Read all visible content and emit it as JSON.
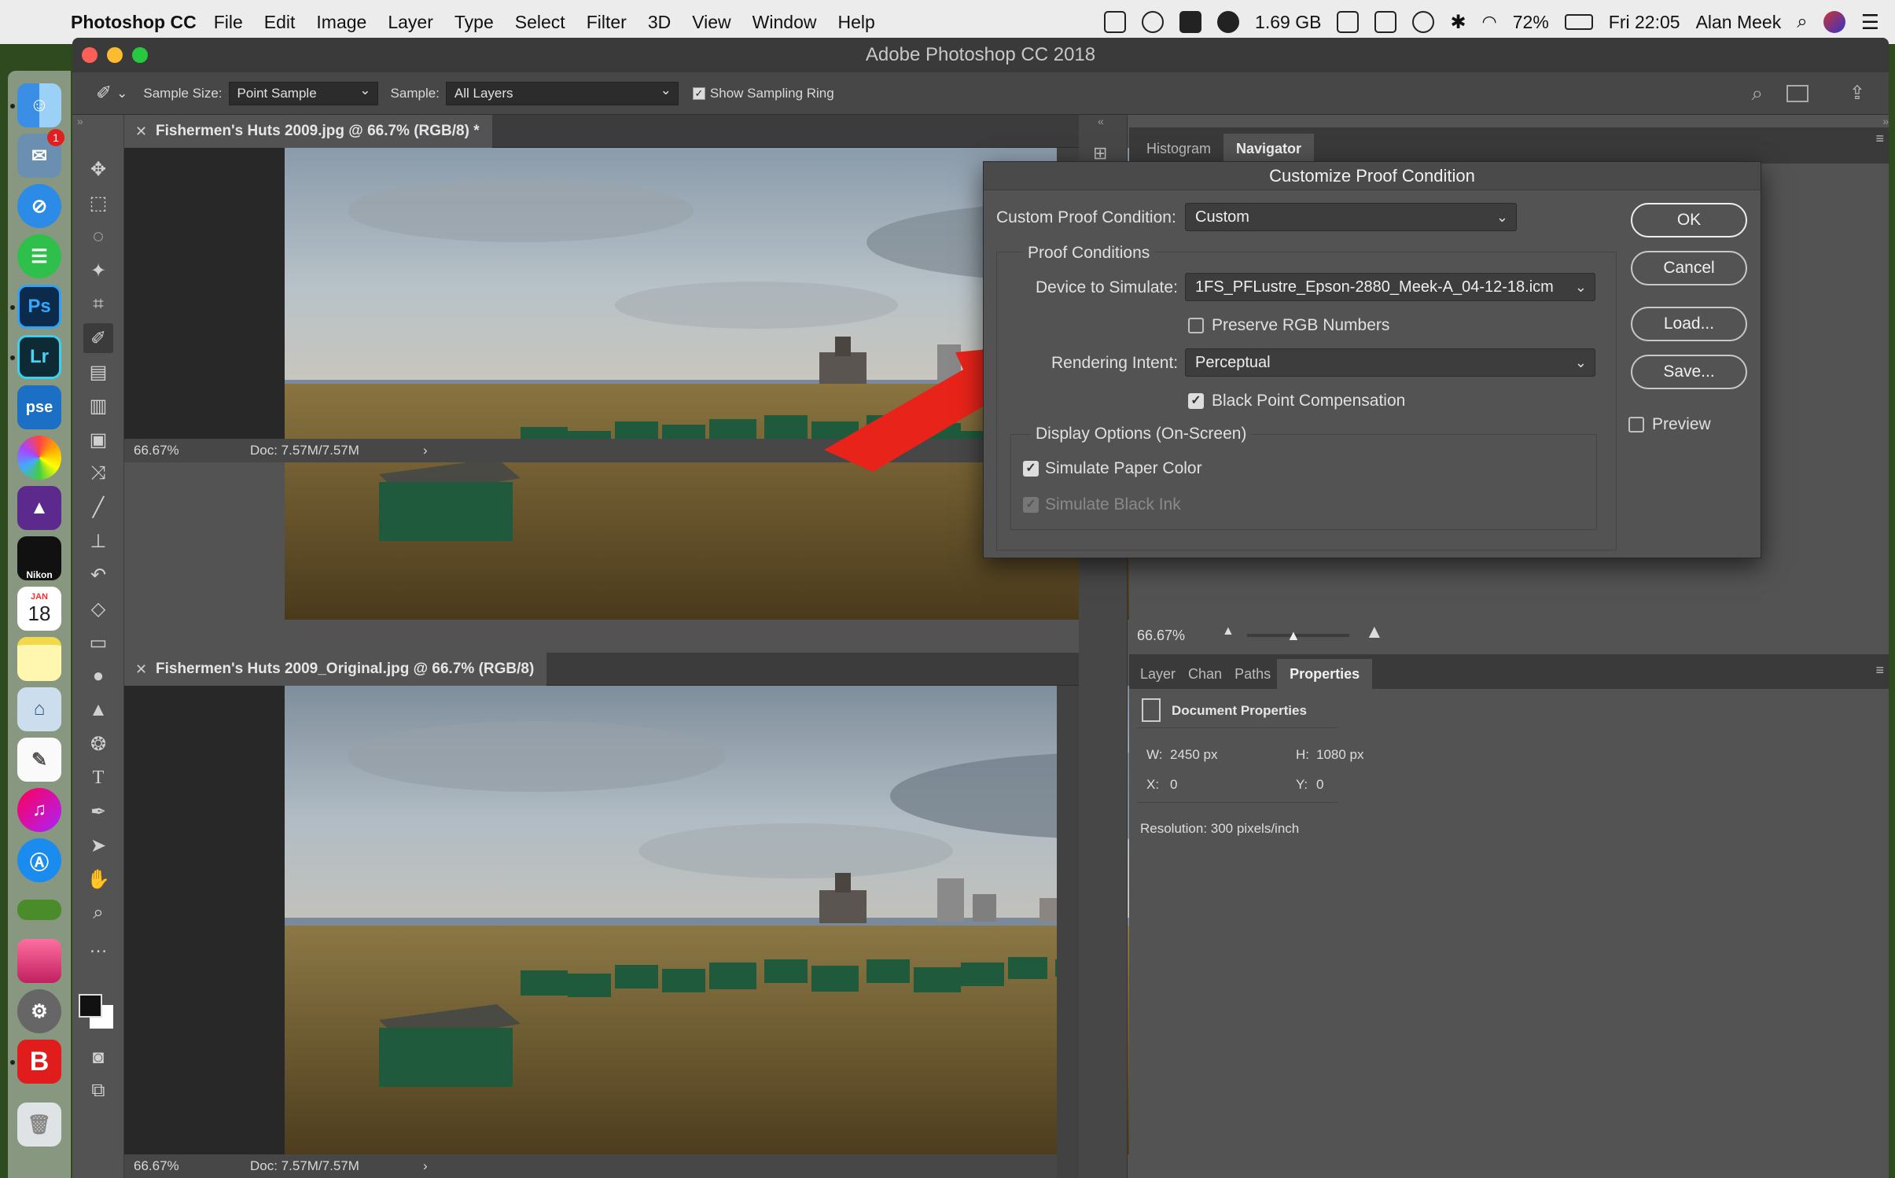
{
  "menubar": {
    "app_name": "Photoshop CC",
    "items": [
      "File",
      "Edit",
      "Image",
      "Layer",
      "Type",
      "Select",
      "Filter",
      "3D",
      "View",
      "Window",
      "Help"
    ],
    "memory": "1.69 GB",
    "battery": "72%",
    "time": "Fri 22:05",
    "user": "Alan Meek"
  },
  "dock": {
    "calendar_month": "JAN",
    "calendar_day": "18",
    "mail_badge": "1",
    "app_labels": [
      "Ps",
      "Lr",
      "pse",
      "Nikon",
      "B"
    ]
  },
  "window": {
    "title": "Adobe Photoshop CC 2018"
  },
  "options_bar": {
    "sample_size_label": "Sample Size:",
    "sample_size_value": "Point Sample",
    "sample_label": "Sample:",
    "sample_value": "All Layers",
    "show_ring_label": "Show Sampling Ring"
  },
  "docs": [
    {
      "title": "Fishermen's Huts 2009.jpg @ 66.7% (RGB/8) *",
      "zoom": "66.67%",
      "doc_size": "Doc: 7.57M/7.57M"
    },
    {
      "title": "Fishermen's Huts 2009_Original.jpg @ 66.7% (RGB/8)",
      "zoom": "66.67%",
      "doc_size": "Doc: 7.57M/7.57M"
    }
  ],
  "navigator": {
    "tabs": [
      "Histogram",
      "Navigator"
    ],
    "zoom": "66.67%"
  },
  "properties": {
    "tabs": [
      "Layer",
      "Chan",
      "Paths",
      "Properties"
    ],
    "heading": "Document Properties",
    "w_label": "W:",
    "w_value": "2450 px",
    "h_label": "H:",
    "h_value": "1080 px",
    "x_label": "X:",
    "x_value": "0",
    "y_label": "Y:",
    "y_value": "0",
    "resolution": "Resolution: 300 pixels/inch"
  },
  "dialog": {
    "title": "Customize Proof Condition",
    "custom_label": "Custom Proof Condition:",
    "custom_value": "Custom",
    "group_label": "Proof Conditions",
    "device_label": "Device to Simulate:",
    "device_value": "1FS_PFLustre_Epson-2880_Meek-A_04-12-18.icm",
    "preserve_label": "Preserve RGB Numbers",
    "preserve_checked": false,
    "intent_label": "Rendering Intent:",
    "intent_value": "Perceptual",
    "bpc_label": "Black Point Compensation",
    "bpc_checked": true,
    "display_label": "Display Options (On-Screen)",
    "paper_label": "Simulate Paper Color",
    "paper_checked": true,
    "ink_label": "Simulate Black Ink",
    "ink_checked": true,
    "ok": "OK",
    "cancel": "Cancel",
    "load": "Load...",
    "save": "Save...",
    "preview_label": "Preview",
    "preview_checked": false
  },
  "colors": {
    "arrow": "#e8231a",
    "hut_green": "#1f5a3c",
    "nav_frame": "#e03030"
  }
}
